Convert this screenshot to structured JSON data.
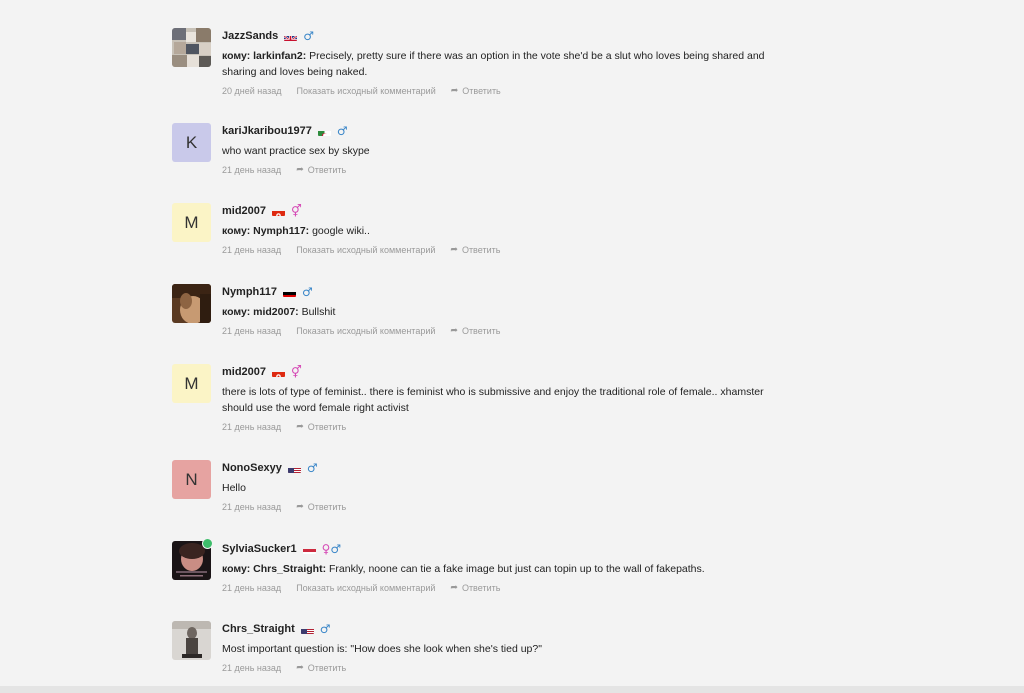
{
  "reply_label": "Ответить",
  "show_original_label": "Показать исходный комментарий",
  "comments": [
    {
      "username": "JazzSands",
      "flag": "gb",
      "gender": "male",
      "to": "кому: larkinfan2:",
      "text": " Precisely, pretty sure if there was an option in the vote she'd be a slut who loves being shared and sharing and loves being naked.",
      "time": "20 дней назад",
      "show_original": true
    },
    {
      "username": "kariJkaribou1977",
      "avatar_letter": "K",
      "flag": "dz",
      "gender": "male",
      "to": "",
      "text": "who want practice sex by skype",
      "time": "21 день назад",
      "show_original": false
    },
    {
      "username": "mid2007",
      "avatar_letter": "M",
      "flag": "hk",
      "gender": "female",
      "to": "кому: Nymph117:",
      "text": " google wiki..",
      "time": "21 день назад",
      "show_original": true
    },
    {
      "username": "Nymph117",
      "flag": "de",
      "gender": "male",
      "to": "кому: mid2007:",
      "text": " Bullshit",
      "time": "21 день назад",
      "show_original": true
    },
    {
      "username": "mid2007",
      "avatar_letter": "M",
      "flag": "hk",
      "gender": "female",
      "to": "",
      "text": "there is lots of type of feminist.. there is feminist who is submissive and enjoy the traditional role of female.. xhamster should use the word female right activist",
      "time": "21 день назад",
      "show_original": false
    },
    {
      "username": "NonoSexyy",
      "avatar_letter": "N",
      "flag": "us",
      "gender": "male",
      "to": "",
      "text": "Hello",
      "time": "21 день назад",
      "show_original": false
    },
    {
      "username": "SylviaSucker1",
      "flag": "hu",
      "gender": "couple",
      "online": true,
      "to": "кому: Chrs_Straight:",
      "text": " Frankly, noone can tie a fake image but just can topin up to the wall of fakepaths.",
      "time": "21 день назад",
      "show_original": true
    },
    {
      "username": "Chrs_Straight",
      "flag": "us",
      "gender": "male",
      "to": "",
      "text": "Most important question is:  \"How does she look when she's tied up?\"",
      "time": "21 день назад",
      "show_original": false
    }
  ]
}
